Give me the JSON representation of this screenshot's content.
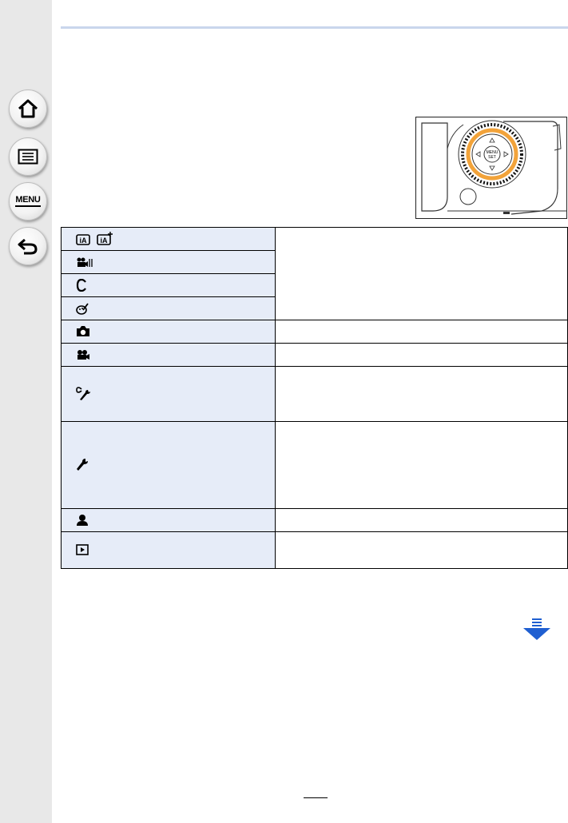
{
  "sidebar": {
    "home_icon": "home-icon",
    "contents_icon": "list-icon",
    "menu_label": "MENU",
    "back_icon": "back-arrow-icon"
  },
  "colors": {
    "sidebar_bg": "#e8e8e8",
    "table_icon_bg": "#e6ecf8",
    "accent_blue": "#1f5fd1",
    "dial_ring": "#f2a33a",
    "top_rule": "#c9d6ec"
  },
  "table": {
    "rows": [
      {
        "icons": [
          "intelligent-auto-mode-icon",
          "intelligent-auto-plus-mode-icon"
        ],
        "description": ""
      },
      {
        "icons": [
          "creative-video-mode-icon"
        ],
        "description": ""
      },
      {
        "icons": [
          "custom-mode-icon"
        ],
        "description": ""
      },
      {
        "icons": [
          "creative-control-mode-icon"
        ],
        "description": ""
      },
      {
        "icons": [
          "rec-camera-icon"
        ],
        "description": ""
      },
      {
        "icons": [
          "motion-picture-icon"
        ],
        "description": ""
      },
      {
        "icons": [
          "custom-wrench-icon"
        ],
        "description": ""
      },
      {
        "icons": [
          "setup-wrench-icon"
        ],
        "description": ""
      },
      {
        "icons": [
          "my-menu-person-icon"
        ],
        "description": ""
      },
      {
        "icons": [
          "playback-icon"
        ],
        "description": ""
      }
    ]
  },
  "camera_illustration": "camera-control-dial-illustration",
  "scroll_indicator": "next-page-arrow-icon"
}
